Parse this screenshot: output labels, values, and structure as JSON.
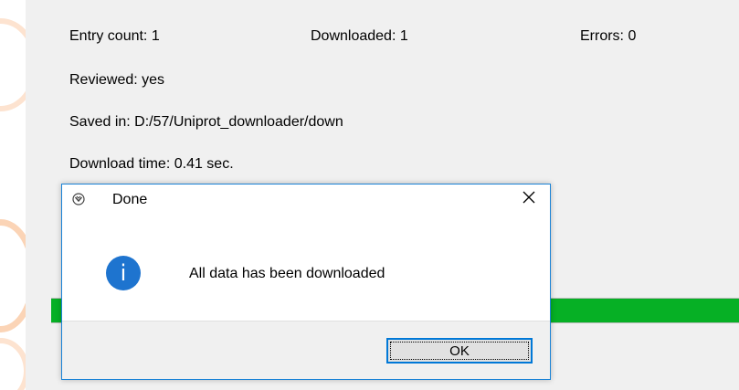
{
  "stats": {
    "entry_count": "Entry count: 1",
    "downloaded": "Downloaded: 1",
    "errors": "Errors: 0",
    "reviewed": "Reviewed: yes",
    "saved_in": "Saved in: D:/57/Uniprot_downloader/down",
    "download_time": "Download time: 0.41 sec."
  },
  "progress": {
    "fraction": 1.0,
    "color": "#06b025"
  },
  "dialog": {
    "title": "Done",
    "message": "All data has been downloaded",
    "ok_label": "OK",
    "close_label": "×",
    "icons": {
      "title": "app-icon",
      "message": "info-icon",
      "close": "close-icon"
    },
    "info_glyph": "i",
    "accent": "#0078d7",
    "info_color": "#1e74cf"
  }
}
